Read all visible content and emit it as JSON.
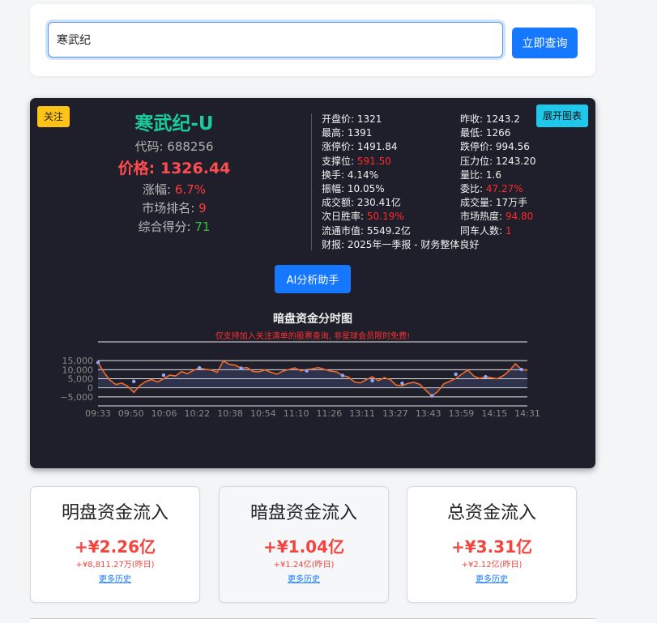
{
  "search": {
    "value": "寒武纪",
    "button_label": "立即查询"
  },
  "panel": {
    "follow_label": "关注",
    "expand_label": "展开图表",
    "name": "寒武纪-U",
    "code_label": "代码:",
    "code": "688256",
    "price_label": "价格:",
    "price": "1326.44",
    "change_label": "涨幅:",
    "change": "6.7%",
    "rank_label": "市场排名:",
    "rank": "9",
    "score_label": "综合得分:",
    "score": "71",
    "ai_button_label": "AI分析助手"
  },
  "metrics": [
    {
      "label": "开盘价:",
      "value": "1321",
      "color": "normal"
    },
    {
      "label": "昨收:",
      "value": "1243.2",
      "color": "normal"
    },
    {
      "label": "最高:",
      "value": "1391",
      "color": "normal"
    },
    {
      "label": "最低:",
      "value": "1266",
      "color": "normal"
    },
    {
      "label": "涨停价:",
      "value": "1491.84",
      "color": "normal"
    },
    {
      "label": "跌停价:",
      "value": "994.56",
      "color": "normal"
    },
    {
      "label": "支撑位:",
      "value": "591.50",
      "color": "red"
    },
    {
      "label": "压力位:",
      "value": "1243.20",
      "color": "normal"
    },
    {
      "label": "换手:",
      "value": "4.14%",
      "color": "normal"
    },
    {
      "label": "量比:",
      "value": "1.6",
      "color": "normal"
    },
    {
      "label": "振幅:",
      "value": "10.05%",
      "color": "normal"
    },
    {
      "label": "委比:",
      "value": "47.27%",
      "color": "red"
    },
    {
      "label": "成交额:",
      "value": "230.41亿",
      "color": "normal"
    },
    {
      "label": "成交量:",
      "value": "17万手",
      "color": "normal"
    },
    {
      "label": "次日胜率:",
      "value": "50.19%",
      "color": "red"
    },
    {
      "label": "市场热度:",
      "value": "94.80",
      "color": "red"
    },
    {
      "label": "流通市值:",
      "value": "5549.2亿",
      "color": "normal"
    },
    {
      "label": "同车人数:",
      "value": "1",
      "color": "red"
    }
  ],
  "report": {
    "label": "财报:",
    "value": "2025年一季报 - 财务整体良好"
  },
  "chart_data": {
    "type": "line",
    "title": "暗盘资金分时图",
    "notice": "仅支持加入关注清单的股票查询, 非星球会员限时免费!",
    "x_ticks": [
      "09:33",
      "09:50",
      "10:06",
      "10:22",
      "10:38",
      "10:54",
      "11:10",
      "11:26",
      "13:11",
      "13:27",
      "13:43",
      "13:59",
      "14:15",
      "14:31"
    ],
    "y_ticks": [
      15000,
      10000,
      5000,
      0,
      -5000
    ],
    "y_tick_labels": [
      "15,000",
      "10,000",
      "5,000",
      "0",
      "−5,000"
    ],
    "ylim": [
      -10000,
      20000
    ],
    "series_color": "#f26a2a",
    "marker_color": "#8fa8ff",
    "values": [
      14000,
      8500,
      4200,
      1800,
      2600,
      800,
      -2600,
      1200,
      3500,
      4500,
      3200,
      5000,
      7000,
      6500,
      8900,
      7800,
      9600,
      11000,
      10200,
      9800,
      8600,
      14800,
      13000,
      12500,
      10800,
      11200,
      9000,
      8800,
      9900,
      8600,
      7500,
      9200,
      10100,
      11000,
      9400,
      10000,
      10500,
      11200,
      10100,
      9200,
      8800,
      6800,
      5900,
      3200,
      2700,
      4500,
      6100,
      3900,
      5600,
      4500,
      1500,
      1200,
      2500,
      3000,
      1800,
      -1500,
      -4500,
      -2000,
      2200,
      3600,
      5200,
      7500,
      9800,
      6500,
      5200,
      6100,
      5500,
      5000,
      6800,
      9500,
      13300,
      10100,
      9700
    ],
    "markers": [
      [
        0,
        14000
      ],
      [
        6,
        3500
      ],
      [
        11,
        7000
      ],
      [
        17,
        11000
      ],
      [
        24,
        10800
      ],
      [
        35,
        9400
      ],
      [
        41,
        6800
      ],
      [
        46,
        3900
      ],
      [
        51,
        2500
      ],
      [
        56,
        -4500
      ],
      [
        60,
        7500
      ],
      [
        65,
        6100
      ],
      [
        71,
        10100
      ]
    ]
  },
  "flows": [
    {
      "title": "明盘资金流入",
      "value": "+¥2.26亿",
      "yesterday": "+¥8,811.27万(昨日)",
      "history": "更多历史"
    },
    {
      "title": "暗盘资金流入",
      "value": "+¥1.04亿",
      "yesterday": "+¥1.24亿(昨日)",
      "history": "更多历史"
    },
    {
      "title": "总资金流入",
      "value": "+¥3.31亿",
      "yesterday": "+¥2.12亿(昨日)",
      "history": "更多历史"
    }
  ]
}
